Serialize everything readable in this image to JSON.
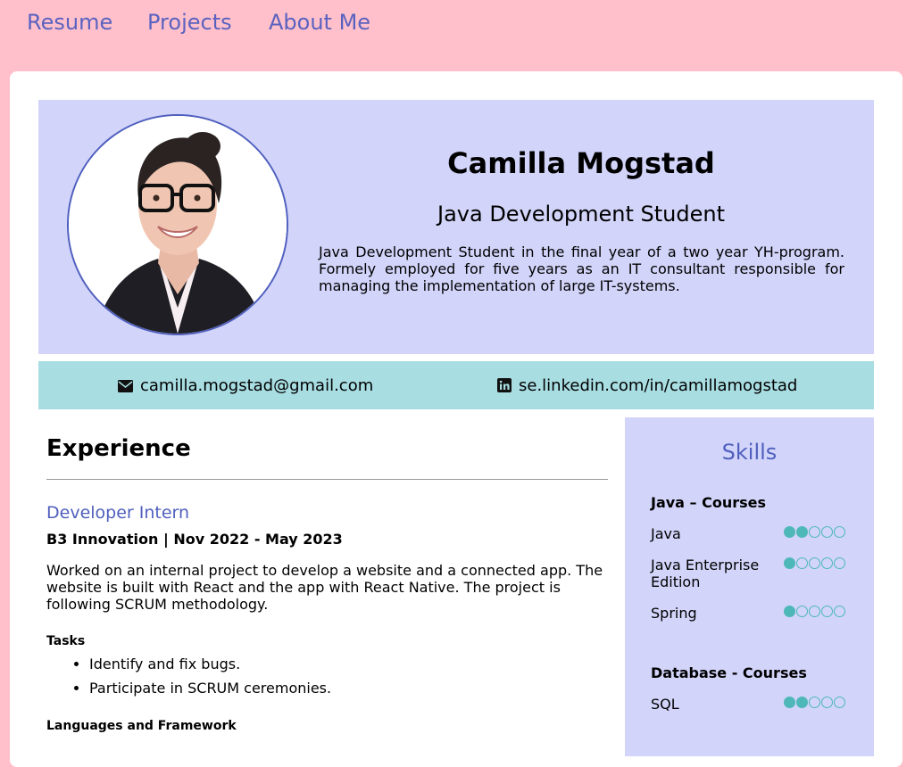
{
  "nav": {
    "items": [
      {
        "label": "Resume"
      },
      {
        "label": "Projects"
      },
      {
        "label": "About Me"
      }
    ]
  },
  "profile": {
    "name": "Camilla Mogstad",
    "role": "Java Development Student",
    "bio": "Java Development Student in the final year of a two year YH-program. Formely employed for five years as an IT consultant responsible for managing the implementation of large IT-systems."
  },
  "contact": {
    "email": "camilla.mogstad@gmail.com",
    "linkedin": "se.linkedin.com/in/camillamogstad"
  },
  "experience": {
    "title": "Experience",
    "job": {
      "title": "Developer Intern",
      "company": "B3 Innovation | Nov 2022 - May 2023",
      "description": "Worked on an internal project to develop a website and a connected app. The website is built with React and the app with React Native. The project is following SCRUM methodology.",
      "tasks_label": "Tasks",
      "tasks": [
        "Identify and fix bugs.",
        "Participate in SCRUM ceremonies."
      ],
      "languages_label": "Languages and Framework"
    }
  },
  "skills": {
    "title": "Skills",
    "groups": [
      {
        "title": "Java – Courses",
        "items": [
          {
            "name": "Java",
            "level": 2,
            "max": 5
          },
          {
            "name": "Java Enterprise Edition",
            "level": 1,
            "max": 5
          },
          {
            "name": "Spring",
            "level": 1,
            "max": 5
          }
        ]
      },
      {
        "title": "Database - Courses",
        "items": [
          {
            "name": "SQL",
            "level": 2,
            "max": 5
          }
        ]
      }
    ]
  },
  "colors": {
    "background": "#ffc0cb",
    "accent": "#4f5fbd",
    "header_panel": "#d2d4fa",
    "contact_bar": "#a8dde2",
    "skill_dot": "#4eb8b8"
  }
}
